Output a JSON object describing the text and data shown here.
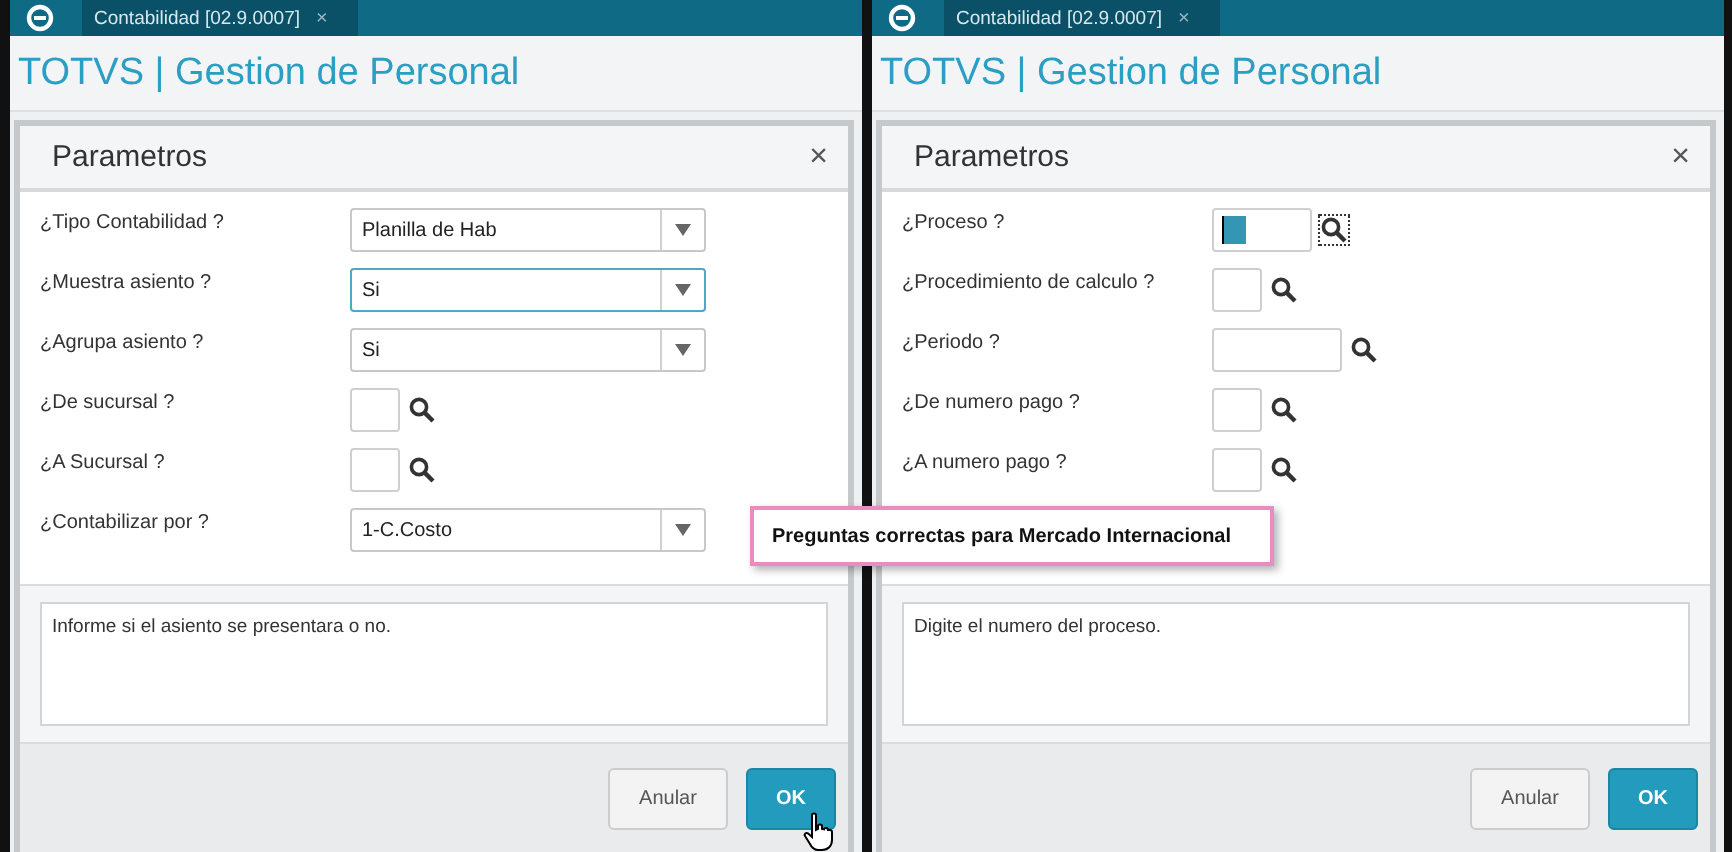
{
  "tooltip": "Preguntas correctas para Mercado Internacional",
  "panels": [
    {
      "tab": {
        "label": "Contabilidad [02.9.0007]",
        "close": "×",
        "selected": true
      },
      "app_title": "TOTVS | Gestion de Personal",
      "dialog": {
        "title": "Parametros",
        "close": "×",
        "fields": [
          {
            "label": "¿Tipo Contabilidad ?",
            "kind": "select",
            "value": "Planilla de Hab",
            "focused": false
          },
          {
            "label": "¿Muestra asiento ?",
            "kind": "select",
            "value": "Si",
            "focused": true
          },
          {
            "label": "¿Agrupa asiento ?",
            "kind": "select",
            "value": "Si",
            "focused": false
          },
          {
            "label": "¿De sucursal ?",
            "kind": "narrow",
            "focused": false
          },
          {
            "label": "¿A Sucursal ?",
            "kind": "narrow",
            "focused": false
          },
          {
            "label": "¿Contabilizar por ?",
            "kind": "select",
            "value": "1-C.Costo",
            "focused": false
          }
        ],
        "help": "Informe si el asiento se presentara o no.",
        "buttons": [
          {
            "label": "Anular",
            "kind": "secondary"
          },
          {
            "label": "OK",
            "kind": "primary",
            "hovered": true
          }
        ]
      }
    },
    {
      "tab": {
        "label": "Contabilidad [02.9.0007]",
        "close": "×",
        "selected": true
      },
      "app_title": "TOTVS | Gestion de Personal",
      "dialog": {
        "title": "Parametros",
        "close": "×",
        "fields": [
          {
            "label": "¿Proceso ?",
            "kind": "medium",
            "focused": true
          },
          {
            "label": "¿Procedimiento de calculo ?",
            "kind": "narrow",
            "focused": false
          },
          {
            "label": "¿Periodo ?",
            "kind": "wide",
            "focused": false
          },
          {
            "label": "¿De numero pago ?",
            "kind": "narrow",
            "focused": false
          },
          {
            "label": "¿A numero pago ?",
            "kind": "narrow",
            "focused": false
          }
        ],
        "help": "Digite el numero del proceso.",
        "buttons": [
          {
            "label": "Anular",
            "kind": "secondary"
          },
          {
            "label": "OK",
            "kind": "primary",
            "hovered": false
          }
        ]
      }
    }
  ]
}
